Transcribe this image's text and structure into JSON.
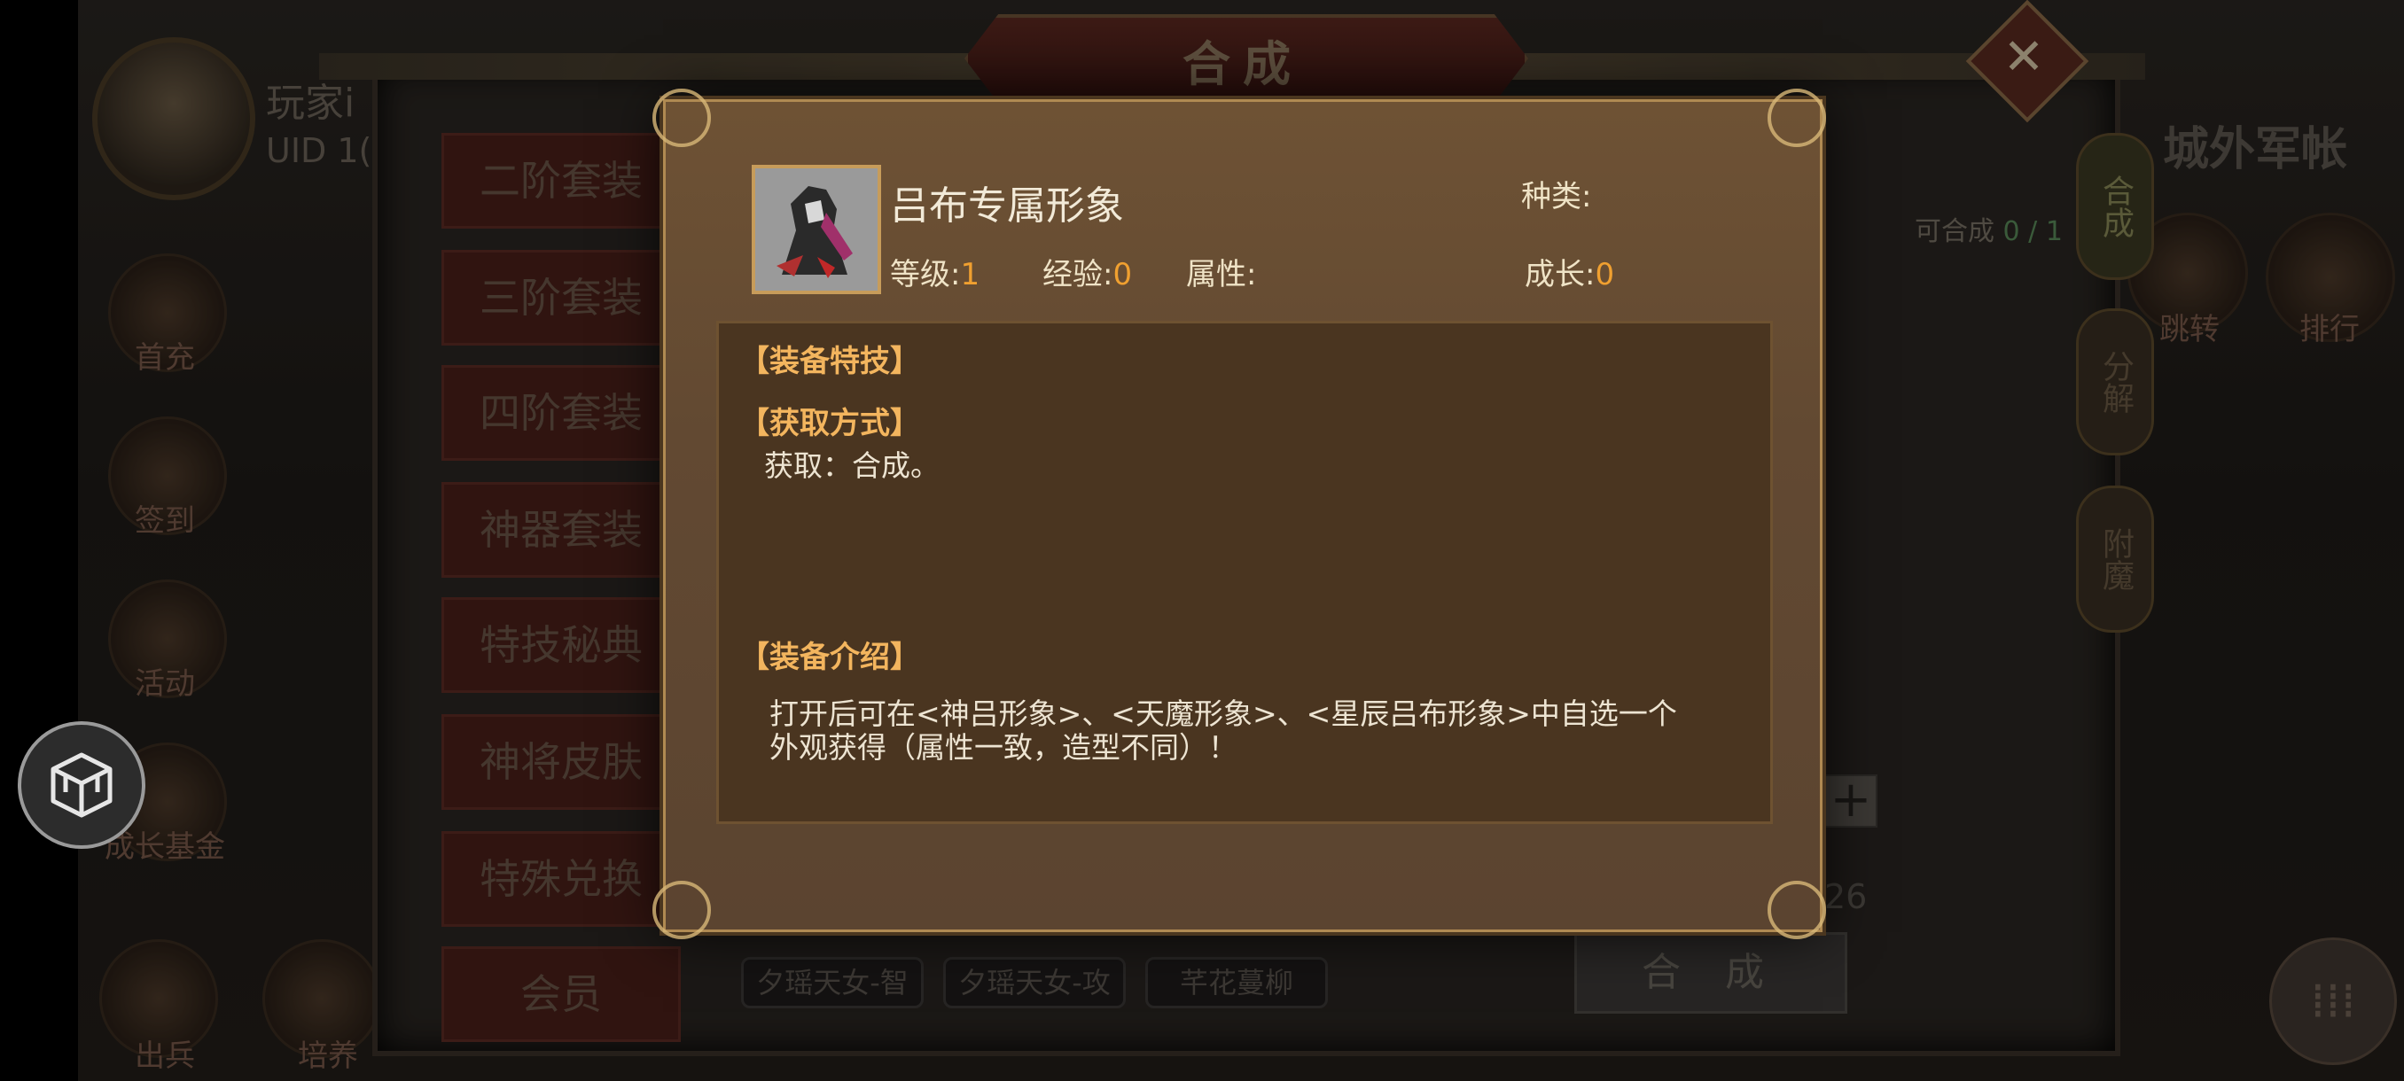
{
  "background": {
    "player_name": "玩家i",
    "uid_text": "UID  1(",
    "left_menu": [
      {
        "label": "首充"
      },
      {
        "label": "签到"
      },
      {
        "label": "活动"
      },
      {
        "label": "成长基金"
      }
    ],
    "bottom_left": [
      {
        "label": "出兵"
      },
      {
        "label": "培养"
      }
    ],
    "right_labels": {
      "settle": "城外军帐",
      "jump": "跳转",
      "rank": "排行"
    }
  },
  "window": {
    "title": "合成",
    "close_icon": "close-x",
    "categories": [
      "二阶套装",
      "三阶套装",
      "四阶套装",
      "神器套装",
      "特技秘典",
      "神将皮肤",
      "特殊兑换",
      "会员"
    ],
    "side_tabs": [
      "合成",
      "分解",
      "附魔"
    ],
    "can_compose_label": "可合成",
    "can_compose_value": "0 / 1",
    "item_tags": [
      "夕瑶天女-智",
      "夕瑶天女-攻",
      "芊花蔓柳"
    ],
    "compose_button": "合 成",
    "plus": "+",
    "count_fragment": "26"
  },
  "dialog": {
    "item_name": "吕布专属形象",
    "type_label": "种类:",
    "type_value": "",
    "level_label": "等级:",
    "level_value": "1",
    "exp_label": "经验:",
    "exp_value": "0",
    "attr_label": "属性:",
    "attr_value": "",
    "growth_label": "成长:",
    "growth_value": "0",
    "sections": {
      "skill_head": "【装备特技】",
      "obtain_head": "【获取方式】",
      "obtain_text": "获取：合成。",
      "intro_head": "【装备介绍】",
      "intro_line1": "打开后可在<神吕形象>、<天魔形象>、<星辰吕布形象>中自选一个",
      "intro_line2": "外观获得（属性一致，造型不同）！"
    }
  },
  "colors": {
    "accent_orange": "#f0a030",
    "dialog_bg": "#624932",
    "section_head": "#f3b55e"
  }
}
